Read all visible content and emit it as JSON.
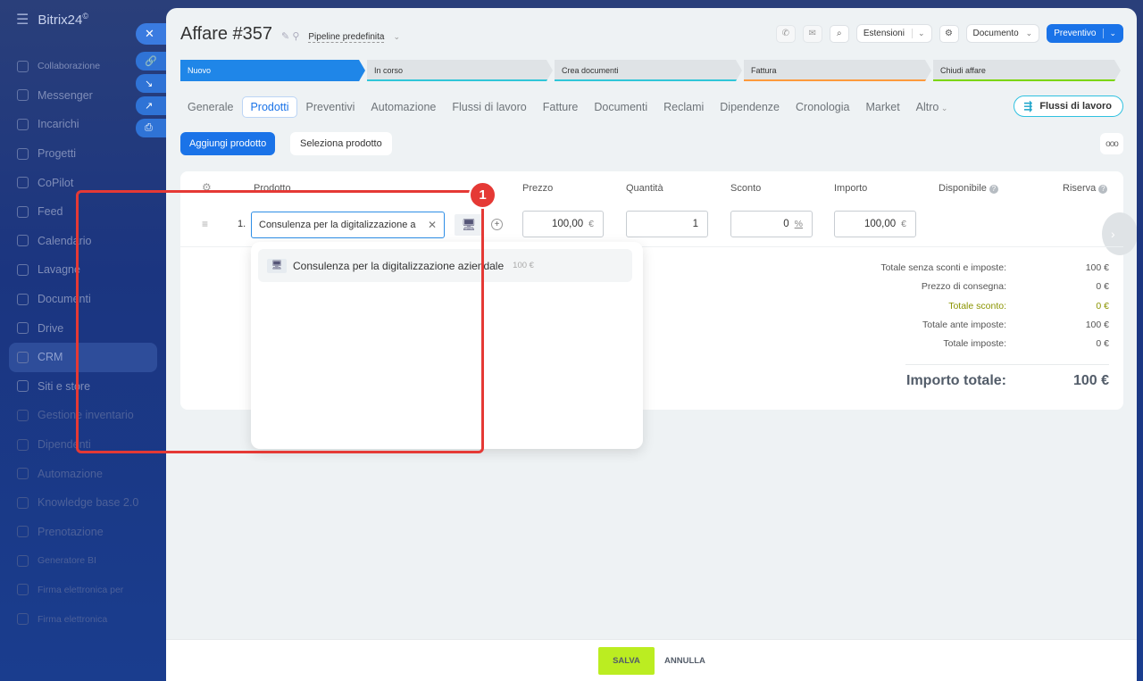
{
  "sidebar": {
    "brand": "Bitrix24",
    "brand_mark": "©",
    "items": [
      {
        "label": "Collaborazione",
        "dim": false,
        "small": true,
        "active": false
      },
      {
        "label": "Messenger",
        "dim": false,
        "small": false,
        "active": false
      },
      {
        "label": "Incarichi",
        "dim": false,
        "small": false,
        "active": false
      },
      {
        "label": "Progetti",
        "dim": false,
        "small": false,
        "active": false
      },
      {
        "label": "CoPilot",
        "dim": false,
        "small": false,
        "active": false
      },
      {
        "label": "Feed",
        "dim": false,
        "small": false,
        "active": false
      },
      {
        "label": "Calendario",
        "dim": false,
        "small": false,
        "active": false
      },
      {
        "label": "Lavagne",
        "dim": false,
        "small": false,
        "active": false
      },
      {
        "label": "Documenti",
        "dim": false,
        "small": false,
        "active": false
      },
      {
        "label": "Drive",
        "dim": false,
        "small": false,
        "active": false
      },
      {
        "label": "CRM",
        "dim": false,
        "small": false,
        "active": true
      },
      {
        "label": "Siti e store",
        "dim": false,
        "small": false,
        "active": false
      },
      {
        "label": "Gestione inventario",
        "dim": true,
        "small": false,
        "active": false
      },
      {
        "label": "Dipendenti",
        "dim": true,
        "small": false,
        "active": false
      },
      {
        "label": "Automazione",
        "dim": true,
        "small": false,
        "active": false
      },
      {
        "label": "Knowledge base 2.0",
        "dim": true,
        "small": false,
        "active": false
      },
      {
        "label": "Prenotazione",
        "dim": true,
        "small": false,
        "active": false
      },
      {
        "label": "Generatore BI",
        "dim": true,
        "small": true,
        "active": false
      },
      {
        "label": "Firma elettronica per",
        "dim": true,
        "small": true,
        "active": false
      },
      {
        "label": "Firma elettronica",
        "dim": true,
        "small": true,
        "active": false
      }
    ]
  },
  "side_buttons": {
    "close": "✕",
    "link": "🔗",
    "arrow": "↘",
    "open": "↗",
    "print": "⎙"
  },
  "header": {
    "title": "Affare #357",
    "pipeline": "Pipeline predefinita",
    "extensions": "Estensioni",
    "document": "Documento",
    "quote": "Preventivo"
  },
  "stages": [
    {
      "label": "Nuovo",
      "width": 207,
      "bar": "#1f86e8"
    },
    {
      "label": "In corso",
      "width": 208,
      "bar": "#2fc6d8"
    },
    {
      "label": "Crea documenti",
      "width": 210,
      "bar": "#2fc6d8"
    },
    {
      "label": "Fattura",
      "width": 210,
      "bar": "#ff9a3c"
    },
    {
      "label": "Chiudi affare",
      "width": 210,
      "bar": "#7bd500"
    }
  ],
  "tabs": [
    {
      "label": "Generale",
      "active": false
    },
    {
      "label": "Prodotti",
      "active": true
    },
    {
      "label": "Preventivi",
      "active": false
    },
    {
      "label": "Automazione",
      "active": false
    },
    {
      "label": "Flussi di lavoro",
      "active": false
    },
    {
      "label": "Fatture",
      "active": false
    },
    {
      "label": "Documenti",
      "active": false
    },
    {
      "label": "Reclami",
      "active": false
    },
    {
      "label": "Dipendenze",
      "active": false
    },
    {
      "label": "Cronologia",
      "active": false
    },
    {
      "label": "Market",
      "active": false
    },
    {
      "label": "Altro",
      "active": false
    }
  ],
  "flussi_button": "Flussi di lavoro",
  "actions": {
    "add_product": "Aggiungi prodotto",
    "select_product": "Seleziona prodotto",
    "more": "ooo"
  },
  "table": {
    "headers": {
      "product": "Prodotto",
      "price": "Prezzo",
      "quantity": "Quantità",
      "discount": "Sconto",
      "amount": "Importo",
      "available": "Disponibile",
      "reserve": "Riserva"
    },
    "row": {
      "number": "1.",
      "product_value": "Consulenza per la digitalizzazione a",
      "price": "100,00",
      "price_unit": "€",
      "quantity": "1",
      "discount": "0",
      "discount_unit": "%",
      "amount": "100,00",
      "amount_unit": "€"
    }
  },
  "dropdown": {
    "item_name": "Consulenza per la digitalizzazione aziendale",
    "item_price": "100 €"
  },
  "totals": [
    {
      "label": "Totale senza sconti e imposte:",
      "value": "100 €",
      "green": false
    },
    {
      "label": "Prezzo di consegna:",
      "value": "0 €",
      "green": false
    },
    {
      "label": "Totale sconto:",
      "value": "0 €",
      "green": true
    },
    {
      "label": "Totale ante imposte:",
      "value": "100 €",
      "green": false
    },
    {
      "label": "Totale imposte:",
      "value": "0 €",
      "green": false
    }
  ],
  "grand_total": {
    "label": "Importo totale:",
    "value": "100 €"
  },
  "annotation": {
    "number": "1"
  },
  "footer": {
    "save": "SALVA",
    "cancel": "ANNULLA"
  }
}
